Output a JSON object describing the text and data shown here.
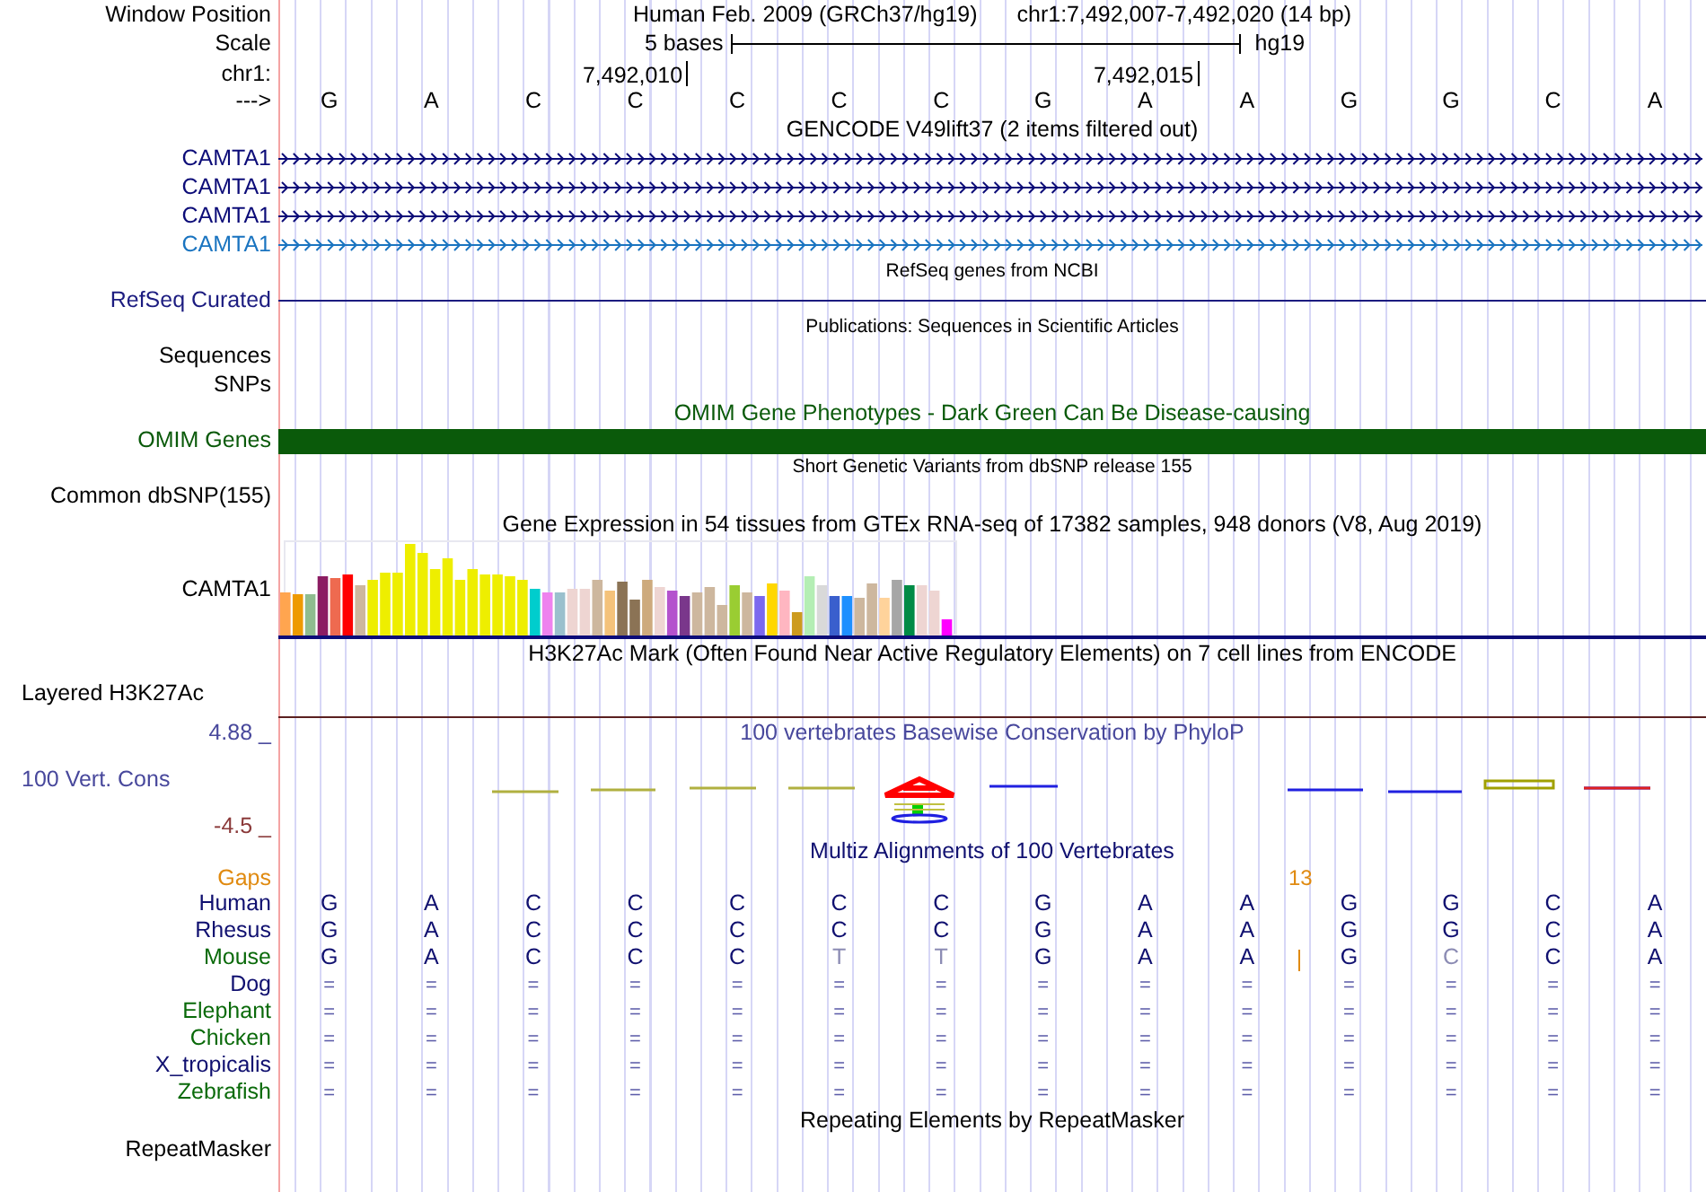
{
  "header": {
    "position_label": "Window Position",
    "assembly": "Human Feb. 2009 (GRCh37/hg19)",
    "position": "chr1:7,492,007-7,492,020 (14 bp)",
    "scale_label": "Scale",
    "scale_text": "5 bases",
    "scale_assembly": "hg19",
    "ruler_label": "chr1:",
    "strand_label": "--->",
    "bases": [
      {
        "base": "G"
      },
      {
        "base": "A"
      },
      {
        "base": "C"
      },
      {
        "base": "C",
        "tick": "7,492,010"
      },
      {
        "base": "C"
      },
      {
        "base": "C"
      },
      {
        "base": "C"
      },
      {
        "base": "G"
      },
      {
        "base": "A",
        "tick": "7,492,015"
      },
      {
        "base": "A"
      },
      {
        "base": "G"
      },
      {
        "base": "G"
      },
      {
        "base": "C"
      },
      {
        "base": "A"
      }
    ]
  },
  "tracks": [
    {
      "kind": "title",
      "text": "GENCODE V49lift37 (2 items filtered out)",
      "color": "#000000"
    },
    {
      "kind": "gene",
      "label": "CAMTA1",
      "color": "#0c0c78"
    },
    {
      "kind": "gene",
      "label": "CAMTA1",
      "color": "#0c0c78"
    },
    {
      "kind": "gene",
      "label": "CAMTA1",
      "color": "#0c0c78"
    },
    {
      "kind": "gene",
      "label": "CAMTA1",
      "color": "#1a74c0"
    },
    {
      "kind": "subtitle",
      "text": "RefSeq genes from NCBI",
      "color": "#000000"
    },
    {
      "kind": "line",
      "label": "RefSeq Curated",
      "color": "#1c1c80"
    },
    {
      "kind": "subtitle",
      "text": "Publications: Sequences in Scientific Articles",
      "color": "#000000"
    },
    {
      "kind": "empty",
      "label": "Sequences",
      "color": "#000000"
    },
    {
      "kind": "empty",
      "label": "SNPs",
      "color": "#000000"
    },
    {
      "kind": "title",
      "text": "OMIM Gene Phenotypes - Dark Green Can Be Disease-causing",
      "color": "#0a5a0a"
    },
    {
      "kind": "bar",
      "label": "OMIM Genes",
      "color": "#0a5a0a"
    },
    {
      "kind": "subtitle",
      "text": "Short Genetic Variants from dbSNP release 155",
      "color": "#000000"
    },
    {
      "kind": "empty",
      "label": "Common dbSNP(155)",
      "color": "#000000"
    },
    {
      "kind": "title",
      "text": "Gene Expression in 54 tissues from GTEx RNA-seq of 17382 samples, 948 donors (V8, Aug 2019)",
      "color": "#000000"
    },
    {
      "kind": "expression",
      "label": "CAMTA1",
      "color": "#000000"
    },
    {
      "kind": "title",
      "text": "H3K27Ac Mark (Often Found Near Active Regulatory Elements) on 7 cell lines from ENCODE",
      "color": "#000000"
    },
    {
      "kind": "layered",
      "label": "Layered H3K27Ac",
      "color": "#000000"
    },
    {
      "kind": "conservation",
      "title": "100 vertebrates Basewise Conservation by PhyloP",
      "label": "100 Vert. Cons",
      "max": "4.88 _",
      "min": "-4.5 _",
      "color": "#48489c"
    },
    {
      "kind": "title",
      "text": "Multiz Alignments of 100 Vertebrates",
      "color": "#101070"
    },
    {
      "kind": "gaps",
      "label": "Gaps",
      "count": "13",
      "color": "#e08a10"
    },
    {
      "kind": "species",
      "label": "Human",
      "color": "#101070",
      "bases": [
        "G",
        "A",
        "C",
        "C",
        "C",
        "C",
        "C",
        "G",
        "A",
        "A",
        "G",
        "G",
        "C",
        "A"
      ],
      "faded": [
        false,
        false,
        false,
        false,
        false,
        false,
        false,
        false,
        false,
        false,
        false,
        false,
        false,
        false
      ]
    },
    {
      "kind": "species",
      "label": "Rhesus",
      "color": "#101070",
      "bases": [
        "G",
        "A",
        "C",
        "C",
        "C",
        "C",
        "C",
        "G",
        "A",
        "A",
        "G",
        "G",
        "C",
        "A"
      ],
      "faded": [
        false,
        false,
        false,
        false,
        false,
        false,
        false,
        false,
        false,
        false,
        false,
        false,
        false,
        false
      ]
    },
    {
      "kind": "species",
      "label": "Mouse",
      "color": "#0a6a0a",
      "bases": [
        "G",
        "A",
        "C",
        "C",
        "C",
        "T",
        "T",
        "G",
        "A",
        "A",
        "G",
        "C",
        "C",
        "A"
      ],
      "faded": [
        false,
        false,
        false,
        false,
        false,
        true,
        true,
        false,
        false,
        false,
        false,
        true,
        false,
        false
      ],
      "insertion": [
        false,
        false,
        false,
        false,
        false,
        false,
        false,
        false,
        false,
        true,
        false,
        false,
        false,
        false
      ]
    },
    {
      "kind": "species",
      "label": "Dog",
      "color": "#101070",
      "bases": [
        "=",
        "=",
        "=",
        "=",
        "=",
        "=",
        "=",
        "=",
        "=",
        "=",
        "=",
        "=",
        "=",
        "="
      ],
      "faded": [
        false,
        false,
        false,
        false,
        false,
        false,
        false,
        false,
        false,
        false,
        false,
        false,
        false,
        false
      ]
    },
    {
      "kind": "species",
      "label": "Elephant",
      "color": "#0a6a0a",
      "bases": [
        "=",
        "=",
        "=",
        "=",
        "=",
        "=",
        "=",
        "=",
        "=",
        "=",
        "=",
        "=",
        "=",
        "="
      ],
      "faded": [
        false,
        false,
        false,
        false,
        false,
        false,
        false,
        false,
        false,
        false,
        false,
        false,
        false,
        false
      ]
    },
    {
      "kind": "species",
      "label": "Chicken",
      "color": "#0a6a0a",
      "bases": [
        "=",
        "=",
        "=",
        "=",
        "=",
        "=",
        "=",
        "=",
        "=",
        "=",
        "=",
        "=",
        "=",
        "="
      ],
      "faded": [
        false,
        false,
        false,
        false,
        false,
        false,
        false,
        false,
        false,
        false,
        false,
        false,
        false,
        false
      ]
    },
    {
      "kind": "species",
      "label": "X_tropicalis",
      "color": "#101070",
      "bases": [
        "=",
        "=",
        "=",
        "=",
        "=",
        "=",
        "=",
        "=",
        "=",
        "=",
        "=",
        "=",
        "=",
        "="
      ],
      "faded": [
        false,
        false,
        false,
        false,
        false,
        false,
        false,
        false,
        false,
        false,
        false,
        false,
        false,
        false
      ]
    },
    {
      "kind": "species",
      "label": "Zebrafish",
      "color": "#0a6a0a",
      "bases": [
        "=",
        "=",
        "=",
        "=",
        "=",
        "=",
        "=",
        "=",
        "=",
        "=",
        "=",
        "=",
        "=",
        "="
      ],
      "faded": [
        false,
        false,
        false,
        false,
        false,
        false,
        false,
        false,
        false,
        false,
        false,
        false,
        false,
        false
      ]
    },
    {
      "kind": "title",
      "text": "Repeating Elements by RepeatMasker",
      "color": "#000000"
    },
    {
      "kind": "empty",
      "label": "RepeatMasker",
      "color": "#000000"
    }
  ]
}
